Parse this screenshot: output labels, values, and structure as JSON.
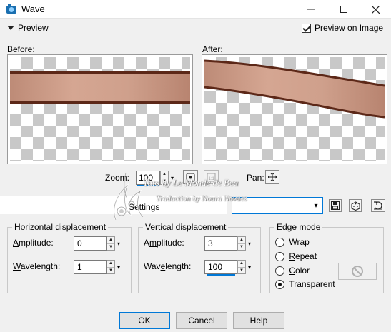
{
  "window": {
    "title": "Wave",
    "minimize_icon": "minimize-icon",
    "maximize_icon": "maximize-icon",
    "close_icon": "close-icon"
  },
  "preview": {
    "toggle_label": "Preview",
    "preview_on_image_label": "Preview on Image",
    "preview_on_image_checked": true,
    "before_label": "Before:",
    "after_label": "After:",
    "stripe_color": "#c99a85",
    "stripe_border_color": "#5c2818"
  },
  "zoom": {
    "label": "Zoom:",
    "value": "100",
    "pan_label": "Pan:",
    "pan_icon": "move-icon",
    "fit_icon": "zoom-fit-icon",
    "actual_size_icon": "actual-size-icon"
  },
  "settings": {
    "label": "Settings",
    "value": "",
    "save_icon": "save-preset-icon",
    "randomize_icon": "dice-icon",
    "reset_icon": "reset-icon"
  },
  "horizontal": {
    "title": "Horizontal displacement",
    "amplitude_label": "Amplitude:",
    "amplitude_value": "0",
    "wavelength_label": "Wavelength:",
    "wavelength_value": "1"
  },
  "vertical": {
    "title": "Vertical displacement",
    "amplitude_label": "Amplitude:",
    "amplitude_value": "3",
    "wavelength_label": "Wavelength:",
    "wavelength_value": "100"
  },
  "edge_mode": {
    "title": "Edge mode",
    "options": [
      "Wrap",
      "Repeat",
      "Color",
      "Transparent"
    ],
    "selected": "Transparent",
    "color_icon": "no-color-icon"
  },
  "buttons": {
    "ok": "OK",
    "cancel": "Cancel",
    "help": "Help"
  },
  "watermark": {
    "line1": "Tuto by Le Monde de Bea",
    "line2": "Traduction by Noura Novaes"
  },
  "accent_color": "#0078d7"
}
